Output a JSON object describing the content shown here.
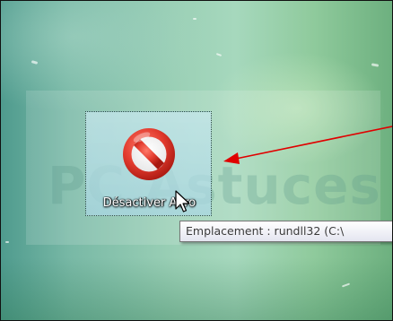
{
  "desktop": {
    "background_colors": [
      "#4f9b8e",
      "#9bd0b6",
      "#6db07f"
    ],
    "watermark": {
      "text": "PC Astuces"
    }
  },
  "shortcut": {
    "label": "Désactiver Aero",
    "icon": "no-entry-icon",
    "selected": true,
    "icon_color": "#e23b2e"
  },
  "tooltip": {
    "text": "Emplacement : rundll32 (C:\\"
  },
  "annotation": {
    "type": "arrow",
    "color": "#e00000"
  },
  "cursor": {
    "icon": "pointer-cursor-icon"
  }
}
